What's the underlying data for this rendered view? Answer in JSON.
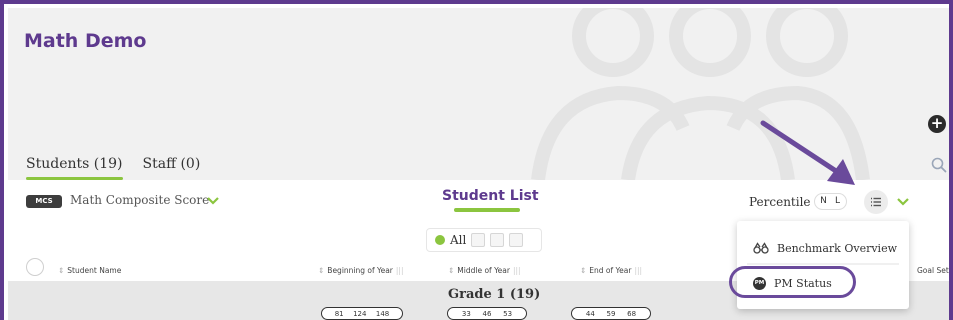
{
  "header": {
    "title": "Math Demo",
    "tabs": [
      {
        "label": "Students (19)",
        "active": true
      },
      {
        "label": "Staff (0)",
        "active": false
      }
    ],
    "add_icon": "plus-circle-icon",
    "search_icon": "search-icon"
  },
  "toolbar": {
    "measure_badge": "MCS",
    "measure_label": "Math Composite Score",
    "list_title": "Student List",
    "percentile_label": "Percentile",
    "percentile_options": [
      "N",
      "L"
    ],
    "view_icon": "list-icon"
  },
  "filter": {
    "selected": "All"
  },
  "columns": {
    "student_name": "Student Name",
    "beginning_of_year": "Beginning of Year",
    "middle_of_year": "Middle of Year",
    "end_of_year": "End of Year",
    "goal_set": "Goal Set"
  },
  "grade": {
    "label": "Grade 1 (19)",
    "boy": [
      "81",
      "124",
      "148"
    ],
    "moy": [
      "33",
      "46",
      "53"
    ],
    "eoy": [
      "44",
      "59",
      "68"
    ]
  },
  "menu": {
    "items": [
      {
        "label": "Benchmark Overview",
        "icon": "binoculars-icon"
      },
      {
        "label": "PM Status",
        "icon": "pm-icon",
        "badge": "PM"
      }
    ]
  },
  "colors": {
    "brand_purple": "#5e3a8e",
    "accent_green": "#8bc53f",
    "header_bg": "#f1f1f1",
    "grade_row_bg": "#e7e7e7"
  }
}
